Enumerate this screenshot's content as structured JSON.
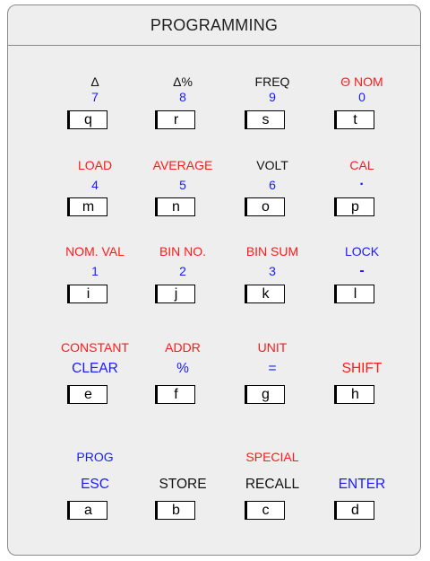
{
  "title": "PROGRAMMING",
  "colors": {
    "red": "#ff1a1a",
    "blue": "#1a1aff",
    "black": "#111111"
  },
  "rows": [
    {
      "keys": [
        {
          "line1": "Δ",
          "line1_color": "black",
          "line2": "7",
          "line2_color": "blue",
          "key": "q"
        },
        {
          "line1": "Δ%",
          "line1_color": "black",
          "line2": "8",
          "line2_color": "blue",
          "key": "r"
        },
        {
          "line1": "FREQ",
          "line1_color": "black",
          "line2": "9",
          "line2_color": "blue",
          "key": "s"
        },
        {
          "line1": "Θ NOM",
          "line1_color": "red",
          "line2": "0",
          "line2_color": "blue",
          "key": "t"
        }
      ]
    },
    {
      "keys": [
        {
          "line1": "LOAD",
          "line1_color": "red",
          "line2": "4",
          "line2_color": "blue",
          "key": "m"
        },
        {
          "line1": "AVERAGE",
          "line1_color": "red",
          "line2": "5",
          "line2_color": "blue",
          "key": "n"
        },
        {
          "line1": "VOLT",
          "line1_color": "black",
          "line2": "6",
          "line2_color": "blue",
          "key": "o"
        },
        {
          "line1": "CAL",
          "line1_color": "red",
          "line2": "·",
          "line2_color": "blue",
          "key": "p"
        }
      ]
    },
    {
      "keys": [
        {
          "line1": "NOM. VAL",
          "line1_color": "red",
          "line2": "1",
          "line2_color": "blue",
          "key": "i"
        },
        {
          "line1": "BIN NO.",
          "line1_color": "red",
          "line2": "2",
          "line2_color": "blue",
          "key": "j"
        },
        {
          "line1": "BIN SUM",
          "line1_color": "red",
          "line2": "3",
          "line2_color": "blue",
          "key": "k"
        },
        {
          "line1": "LOCK",
          "line1_color": "blue",
          "line2": "-",
          "line2_color": "blue",
          "key": "l"
        }
      ]
    },
    {
      "keys": [
        {
          "line1": "CONSTANT",
          "line1_color": "red",
          "line2": "CLEAR",
          "line2_color": "blue",
          "key": "e"
        },
        {
          "line1": "ADDR",
          "line1_color": "red",
          "line2": "%",
          "line2_color": "blue",
          "key": "f"
        },
        {
          "line1": "UNIT",
          "line1_color": "red",
          "line2": "=",
          "line2_color": "blue",
          "key": "g"
        },
        {
          "line1": "",
          "line1_color": "red",
          "line2": "SHIFT",
          "line2_color": "red",
          "key": "h"
        }
      ]
    },
    {
      "keys": [
        {
          "line1": "PROG",
          "line1_color": "blue",
          "line2": "ESC",
          "line2_color": "blue",
          "key": "a"
        },
        {
          "line1": "",
          "line1_color": "black",
          "line2": "STORE",
          "line2_color": "black",
          "key": "b"
        },
        {
          "line1": "SPECIAL",
          "line1_color": "red",
          "line2": "RECALL",
          "line2_color": "black",
          "key": "c"
        },
        {
          "line1": "",
          "line1_color": "black",
          "line2": "ENTER",
          "line2_color": "blue",
          "key": "d"
        }
      ]
    }
  ]
}
